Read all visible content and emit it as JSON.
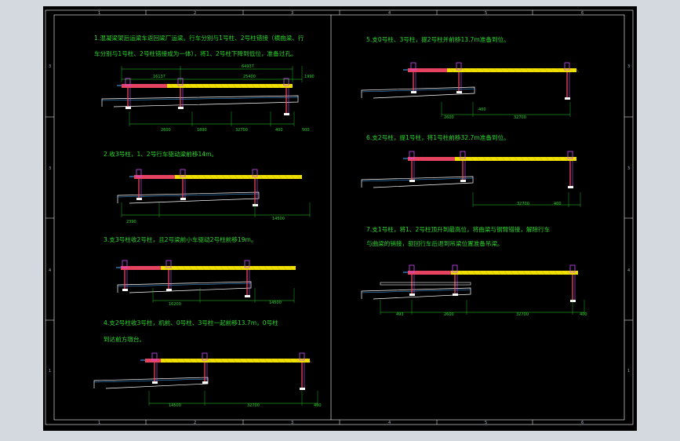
{
  "colors": {
    "background": "#000000",
    "frame": "#ffffff",
    "text": "#2bd82b",
    "girder": "#f0e000",
    "pier": "#ff4a6a",
    "beam": "#ffffff",
    "crossbeam": "#d04aff",
    "outer": "#d4d9df"
  },
  "border_refs": {
    "top": [
      "1",
      "2",
      "3",
      "4",
      "5",
      "6"
    ],
    "bottom": [
      "1",
      "2",
      "3",
      "4",
      "5",
      "6"
    ],
    "left": [
      "3",
      "3",
      "4",
      "1"
    ],
    "right": [
      "3",
      "3",
      "4",
      "1"
    ]
  },
  "steps": [
    {
      "text_lines": [
        "1.混凝梁架后运梁车返回梁厂运梁。行车分别与1号柱、2号柱错接（横曲梁、行",
        "车分别与1号柱、2号柱错接成为一体），将1、2号柱下降到低位，准备过孔。"
      ],
      "dims_top": [
        "64937",
        "16137",
        "25400",
        "1990"
      ],
      "dims_bottom": [
        "2600",
        "1890",
        "32700",
        "400",
        "500"
      ]
    },
    {
      "text_lines": [
        "2.收3号柱，1、2号行车驱动梁前移14m。"
      ],
      "dims_bottom": [
        "2390",
        "14500"
      ]
    },
    {
      "text_lines": [
        "3.支3号柱收2号柱，且2号梁前小车驱动2号柱前移19m。"
      ],
      "dims_bottom": [
        "16200",
        "14500"
      ]
    },
    {
      "text_lines": [
        "4.支2号柱收3号柱，机前、0号柱、3号柱一起前移13.7m，0号柱",
        "到达前方墩台。"
      ],
      "dims_bottom": [
        "14500",
        "32700",
        "400"
      ]
    },
    {
      "text_lines": [
        "5.支0号柱、3号柱，提2号柱并前移13.7m准备到位。"
      ],
      "dims_bottom": [
        "2600",
        "400",
        "32700"
      ]
    },
    {
      "text_lines": [
        "6.支2号柱，提1号柱，将1号柱前移32.7m准备到位。"
      ],
      "dims_bottom": [
        "32700",
        "400"
      ]
    },
    {
      "text_lines": [
        "7.支1号柱，将1、2号柱顶升到最高位，将曲梁与钢臂错接，解除行车",
        "与曲梁的销接，驱回行车后退到吊梁位置准备吊梁。"
      ],
      "dims_bottom": [
        "493",
        "2600",
        "32700",
        "400"
      ]
    }
  ]
}
